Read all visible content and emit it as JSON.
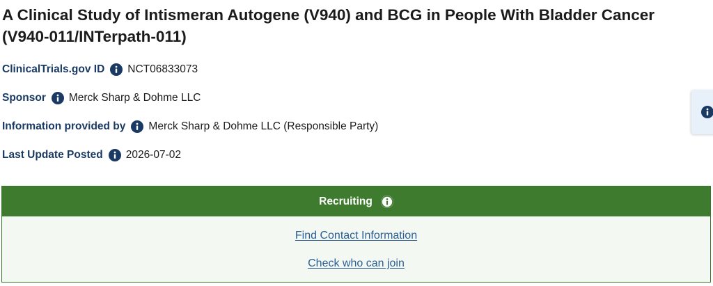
{
  "study": {
    "title": "A Clinical Study of Intismeran Autogene (V940) and BCG in People With Bladder Cancer (V940-011/INTerpath-011)"
  },
  "details": [
    {
      "label": "ClinicalTrials.gov ID",
      "value": "NCT06833073"
    },
    {
      "label": "Sponsor",
      "value": "Merck Sharp & Dohme LLC"
    },
    {
      "label": "Information provided by",
      "value": "Merck Sharp & Dohme LLC (Responsible Party)"
    },
    {
      "label": "Last Update Posted",
      "value": "2026-07-02"
    }
  ],
  "status": {
    "label": "Recruiting",
    "links": [
      "Find Contact Information",
      "Check who can join"
    ]
  },
  "icons": {
    "info": "info-circle-icon"
  },
  "colors": {
    "label_navy": "#1a3a64",
    "status_green": "#3e7b2e",
    "link_blue": "#2b5f95",
    "panel_bg": "#f4f8f2"
  }
}
